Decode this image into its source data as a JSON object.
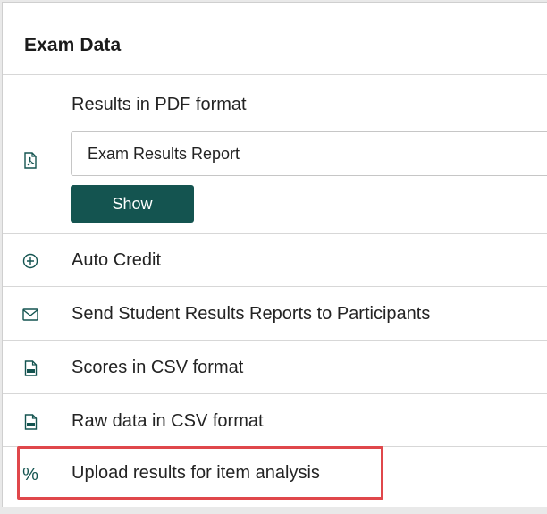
{
  "panel": {
    "title": "Exam Data"
  },
  "pdf_section": {
    "label": "Results in PDF format",
    "select_value": "Exam Results Report",
    "show_label": "Show"
  },
  "items": [
    {
      "label": "Auto Credit",
      "icon": "plus-circle-icon"
    },
    {
      "label": "Send Student Results Reports to Participants",
      "icon": "envelope-icon"
    },
    {
      "label": "Scores in CSV format",
      "icon": "csv-file-icon"
    },
    {
      "label": "Raw data in CSV format",
      "icon": "csv-file-icon"
    },
    {
      "label": "Upload results for item analysis",
      "icon": "percent-icon"
    }
  ],
  "colors": {
    "accent": "#145450",
    "highlight": "#e0474b",
    "icon": "#145450"
  }
}
